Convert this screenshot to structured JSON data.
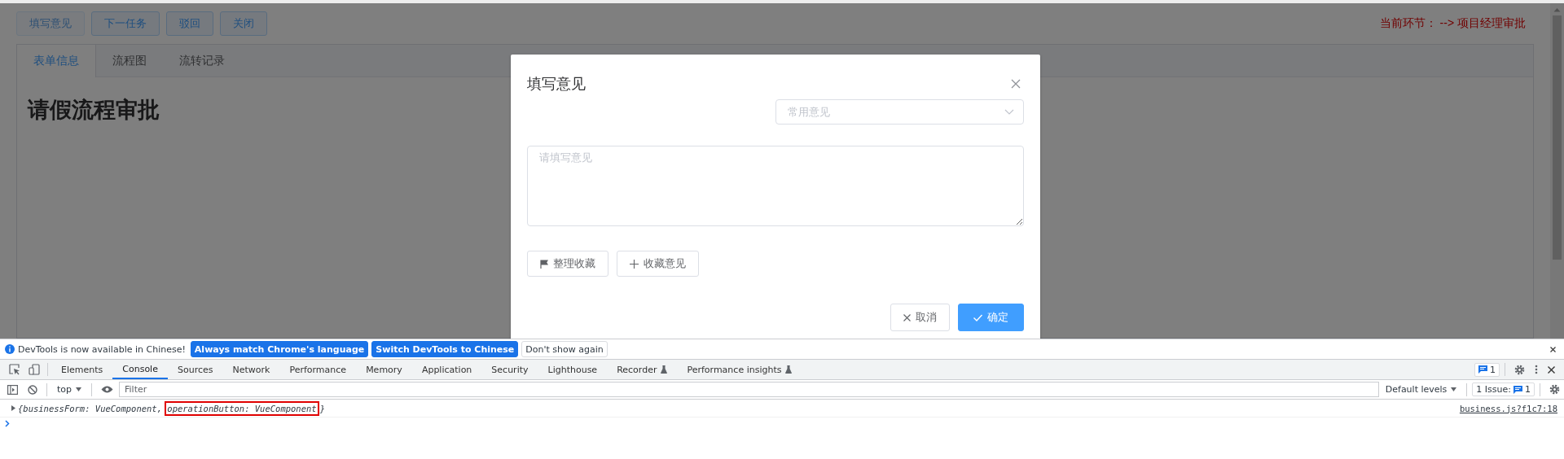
{
  "page": {
    "toolbar_buttons": [
      {
        "label": "填写意见",
        "disabled": true
      },
      {
        "label": "下一任务",
        "disabled": false
      },
      {
        "label": "驳回",
        "disabled": false
      },
      {
        "label": "关闭",
        "disabled": false
      }
    ],
    "current_step": "当前环节： --> 项目经理审批",
    "tabs": [
      {
        "label": "表单信息",
        "selected": true
      },
      {
        "label": "流程图",
        "selected": false
      },
      {
        "label": "流转记录",
        "selected": false
      }
    ],
    "form_title": "请假流程审批"
  },
  "dialog": {
    "title": "填写意见",
    "common_opinions": {
      "placeholder": "常用意见"
    },
    "opinion": {
      "placeholder": "请填写意见"
    },
    "actions": [
      {
        "label": "整理收藏",
        "kind": "flag"
      },
      {
        "label": "收藏意见",
        "kind": "plus"
      }
    ],
    "footer_buttons": [
      {
        "label": "取消",
        "kind": "plain"
      },
      {
        "label": "确定",
        "kind": "primary"
      }
    ]
  },
  "devtools": {
    "infobar": {
      "message": "DevTools is now available in Chinese!",
      "buttons": [
        {
          "label": "Always match Chrome's language",
          "kind": "primary"
        },
        {
          "label": "Switch DevTools to Chinese",
          "kind": "primary"
        },
        {
          "label": "Don't show again",
          "kind": "plain"
        }
      ]
    },
    "tabs": [
      {
        "label": "Elements",
        "selected": false,
        "experimental": false
      },
      {
        "label": "Console",
        "selected": true,
        "experimental": false
      },
      {
        "label": "Sources",
        "selected": false,
        "experimental": false
      },
      {
        "label": "Network",
        "selected": false,
        "experimental": false
      },
      {
        "label": "Performance",
        "selected": false,
        "experimental": false
      },
      {
        "label": "Memory",
        "selected": false,
        "experimental": false
      },
      {
        "label": "Application",
        "selected": false,
        "experimental": false
      },
      {
        "label": "Security",
        "selected": false,
        "experimental": false
      },
      {
        "label": "Lighthouse",
        "selected": false,
        "experimental": false
      },
      {
        "label": "Recorder",
        "selected": false,
        "experimental": true
      },
      {
        "label": "Performance insights",
        "selected": false,
        "experimental": true
      }
    ],
    "messages_count": "1",
    "console_toolbar": {
      "context": "top",
      "filter_placeholder": "Filter",
      "levels": "Default levels",
      "issues_label": "1 Issue:",
      "issues_count": "1"
    },
    "log": [
      {
        "segments": [
          {
            "text": "{businessForm: VueComponent, ",
            "highlighted": false
          },
          {
            "text": "operationButton: VueComponent",
            "highlighted": true
          },
          {
            "text": "}",
            "highlighted": false
          }
        ],
        "source": "business.js?f1c7:18"
      }
    ]
  }
}
